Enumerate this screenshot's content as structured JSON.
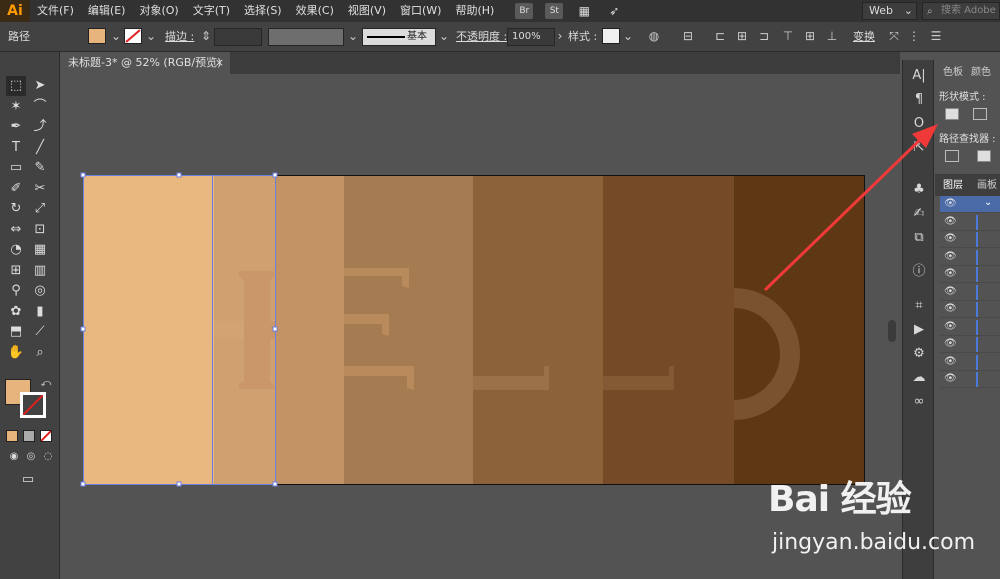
{
  "app": {
    "logo": "Ai"
  },
  "menu": [
    "文件(F)",
    "编辑(E)",
    "对象(O)",
    "文字(T)",
    "选择(S)",
    "效果(C)",
    "视图(V)",
    "窗口(W)",
    "帮助(H)"
  ],
  "menu_icons": [
    {
      "name": "bridge-icon",
      "label": "Br"
    },
    {
      "name": "stock-icon",
      "label": "St"
    }
  ],
  "workspace": {
    "label": "Web"
  },
  "search": {
    "placeholder": "搜索 Adobe"
  },
  "control": {
    "object_type": "路径",
    "stroke_label": "描边 :",
    "stroke_profile": "基本",
    "opacity_label": "不透明度 :",
    "opacity_value": "100%",
    "style_label": "样式 :",
    "transform_label": "变换",
    "fill_color": "#e8b47e"
  },
  "document_tab": {
    "title": "未标题-3* @ 52% (RGB/预览)",
    "close": "×"
  },
  "panels": {
    "tab_swatches": "色板",
    "tab_color": "颜色",
    "shape_modes_label": "形状模式 :",
    "pathfinder_label": "路径查找器 :",
    "tab_layers": "图层",
    "tab_artboards": "画板"
  },
  "artwork": {
    "stripe_colors": [
      "#e8b880",
      "#cfa070",
      "#c39365",
      "#a57b52",
      "#8c6239",
      "#754b27",
      "#5e3714"
    ],
    "letters": [
      "H",
      "E",
      "L",
      "L",
      "O"
    ]
  },
  "layers": {
    "row_count": 11
  },
  "watermark": {
    "logo": "Bai 经验",
    "url": "jingyan.baidu.com"
  }
}
